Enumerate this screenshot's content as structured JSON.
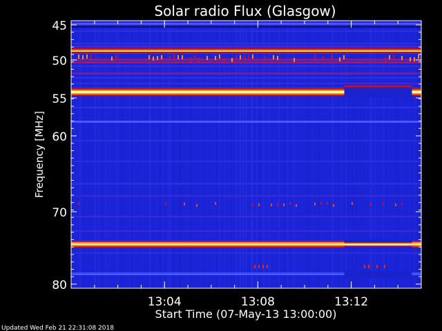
{
  "chart_data": {
    "type": "heatmap",
    "title": "Solar radio Flux (Glasgow)",
    "ylabel": "Frequency [MHz]",
    "xlabel": "Start Time (07-May-13 13:00:00)",
    "footer": "Updated Wed Feb 21 22:31:08 2018",
    "y_ticks": [
      "45",
      "50",
      "55",
      "60",
      "70",
      "80"
    ],
    "x_ticks": [
      "13:04",
      "13:08",
      "13:12"
    ],
    "x_range_minutes": [
      0,
      15
    ],
    "y_range_mhz": [
      44.5,
      80.5
    ],
    "colors": {
      "background": "#1c24d8",
      "band_weak": "#3e1fd0",
      "band_mid": "#c01040",
      "band_strong": "#ff8a20",
      "band_core": "#ffffa0",
      "dark_gap": "#101060"
    }
  }
}
